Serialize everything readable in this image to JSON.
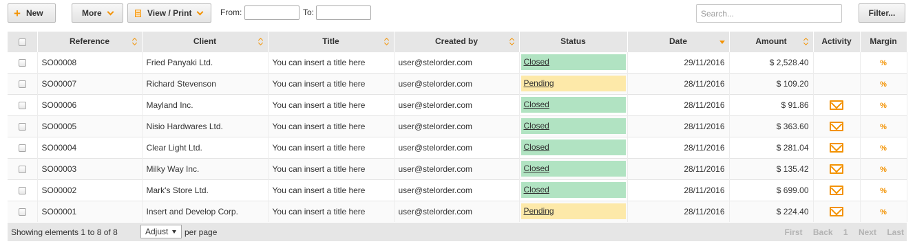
{
  "toolbar": {
    "new_label": "New",
    "more_label": "More",
    "view_print_label": "View / Print",
    "from_label": "From:",
    "to_label": "To:",
    "from_value": "",
    "to_value": "",
    "search_placeholder": "Search...",
    "filter_label": "Filter..."
  },
  "table": {
    "columns": [
      "Reference",
      "Client",
      "Title",
      "Created by",
      "Status",
      "Date",
      "Amount",
      "Activity",
      "Margin"
    ],
    "sorted_column": "Date",
    "rows": [
      {
        "reference": "SO00008",
        "client": "Fried Panyaki Ltd.",
        "title": "You can insert a title here",
        "created_by": "user@stelorder.com",
        "status": "Closed",
        "date": "29/11/2016",
        "amount": "$ 2,528.40",
        "activity": "",
        "margin": "%"
      },
      {
        "reference": "SO00007",
        "client": "Richard Stevenson",
        "title": "You can insert a title here",
        "created_by": "user@stelorder.com",
        "status": "Pending",
        "date": "28/11/2016",
        "amount": "$ 109.20",
        "activity": "",
        "margin": "%"
      },
      {
        "reference": "SO00006",
        "client": "Mayland Inc.",
        "title": "You can insert a title here",
        "created_by": "user@stelorder.com",
        "status": "Closed",
        "date": "28/11/2016",
        "amount": "$ 91.86",
        "activity": "email",
        "margin": "%"
      },
      {
        "reference": "SO00005",
        "client": "Nisio Hardwares Ltd.",
        "title": "You can insert a title here",
        "created_by": "user@stelorder.com",
        "status": "Closed",
        "date": "28/11/2016",
        "amount": "$ 363.60",
        "activity": "email",
        "margin": "%"
      },
      {
        "reference": "SO00004",
        "client": "Clear Light Ltd.",
        "title": "You can insert a title here",
        "created_by": "user@stelorder.com",
        "status": "Closed",
        "date": "28/11/2016",
        "amount": "$ 281.04",
        "activity": "email",
        "margin": "%"
      },
      {
        "reference": "SO00003",
        "client": "Milky Way Inc.",
        "title": "You can insert a title here",
        "created_by": "user@stelorder.com",
        "status": "Closed",
        "date": "28/11/2016",
        "amount": "$ 135.42",
        "activity": "email",
        "margin": "%"
      },
      {
        "reference": "SO00002",
        "client": "Mark's Store Ltd.",
        "title": "You can insert a title here",
        "created_by": "user@stelorder.com",
        "status": "Closed",
        "date": "28/11/2016",
        "amount": "$ 699.00",
        "activity": "email",
        "margin": "%"
      },
      {
        "reference": "SO00001",
        "client": "Insert and Develop Corp.",
        "title": "You can insert a title here",
        "created_by": "user@stelorder.com",
        "status": "Pending",
        "date": "28/11/2016",
        "amount": "$ 224.40",
        "activity": "email",
        "margin": "%"
      }
    ]
  },
  "footer": {
    "count_text": "Showing elements 1 to 8 of 8",
    "page_size": "Adjust",
    "per_page_label": "per page",
    "pager": [
      "First",
      "Back",
      "1",
      "Next",
      "Last"
    ]
  },
  "colors": {
    "accent": "#f39200",
    "status_closed": "#b1e3c2",
    "status_pending": "#fde9a9",
    "header_bg": "#e6e6e6"
  },
  "icons": {
    "new": "plus-icon",
    "dropdown": "chevron-down-icon",
    "view_print": "document-icon",
    "activity": "mail-icon",
    "sort": "sort-arrows-icon"
  }
}
